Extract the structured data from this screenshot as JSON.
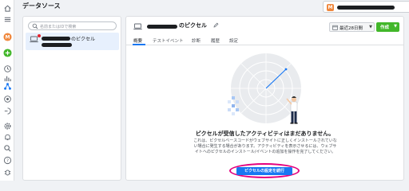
{
  "header": {
    "title": "データソース",
    "account_initial": "M"
  },
  "left_panel": {
    "search_placeholder": "名前またはIDで検索",
    "pixel_item_label": "のピクセル"
  },
  "main": {
    "pixel_title": "のピクセル",
    "date_range_label": "最近28日間",
    "create_label": "作成",
    "tabs": [
      {
        "label": "概要",
        "active": true
      },
      {
        "label": "テストイベント",
        "active": false
      },
      {
        "label": "診断",
        "active": false
      },
      {
        "label": "履歴",
        "active": false
      },
      {
        "label": "設定",
        "active": false
      }
    ],
    "empty_title": "ピクセルが受信したアクティビティはまだありません。",
    "empty_body": "これは、ピクセルベースコードがウェブサイトに正しくインストールされていない場合に発生する場合があります。アクティビティを表示させるには、ウェブサイトへのピクセルのインストール/イベントの追加を操作を完了してください。",
    "cta_label": "ピクセルの設定を続行"
  },
  "colors": {
    "primary": "#1877f2",
    "create_green": "#42b72a",
    "highlight_ring": "#e4007f",
    "account_badge": "#f0883e",
    "alert_red": "#e4222e"
  },
  "icons": {
    "rail": [
      "home-icon",
      "menu-icon",
      "account-icon",
      "add-icon",
      "clock-icon",
      "chart-icon",
      "network-icon",
      "target-icon",
      "audience-icon",
      "settings-icon",
      "bell-icon",
      "search-icon",
      "help-icon",
      "bug-icon"
    ]
  }
}
